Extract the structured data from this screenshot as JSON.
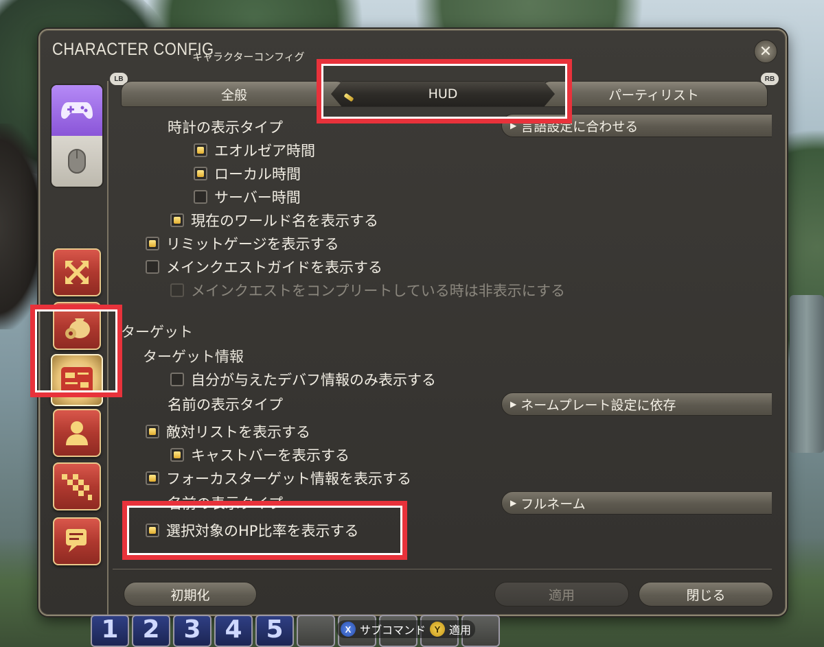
{
  "window": {
    "title_en": "CHARACTER CONFIG",
    "title_ja": "キャラクターコンフィグ",
    "close_glyph": "✕"
  },
  "shoulder": {
    "left": "LB",
    "right": "RB"
  },
  "tabs": [
    {
      "label": "全般"
    },
    {
      "label": "HUD",
      "active": true
    },
    {
      "label": "パーティリスト"
    }
  ],
  "sidebar": {
    "input_modes": [
      "gamepad",
      "mouse"
    ],
    "icons": [
      "arrows-icon",
      "gear-bag-icon",
      "hud-card-icon",
      "person-icon",
      "party-checker-icon",
      "chat-icon"
    ],
    "selected": "hud-card-icon"
  },
  "settings": {
    "clock_type_label": "時計の表示タイプ",
    "clock_dropdown": "言語設定に合わせる",
    "eorzea_time": "エオルゼア時間",
    "local_time": "ローカル時間",
    "server_time": "サーバー時間",
    "world_name": "現在のワールド名を表示する",
    "limit_gauge": "リミットゲージを表示する",
    "msq_guide": "メインクエストガイドを表示する",
    "msq_hide": "メインクエストをコンプリートしている時は非表示にする",
    "target_section": "ターゲット",
    "target_info": "ターゲット情報",
    "own_debuffs": "自分が与えたデバフ情報のみ表示する",
    "name_type_label": "名前の表示タイプ",
    "name_type_dropdown": "ネームプレート設定に依存",
    "enmity_list": "敵対リストを表示する",
    "cast_bar": "キャストバーを表示する",
    "focus_target": "フォーカスターゲット情報を表示する",
    "focus_name_type_label": "名前の表示タイプ",
    "focus_name_dropdown": "フルネーム",
    "hp_ratio": "選択対象のHP比率を表示する"
  },
  "buttons": {
    "reset": "初期化",
    "apply": "適用",
    "close": "閉じる"
  },
  "hotbar": {
    "keys": [
      "1",
      "2",
      "3",
      "4",
      "5"
    ],
    "hint_subcommand": "サブコマンド",
    "hint_apply": "適用",
    "hint_x_glyph": "X",
    "hint_y_glyph": "Y"
  },
  "colors": {
    "highlight_red": "#e8323b",
    "checkbox_on": "#f0c24a",
    "sidebar_icon_red": "#b0392f",
    "gamepad_purple": "#8a55d8"
  }
}
